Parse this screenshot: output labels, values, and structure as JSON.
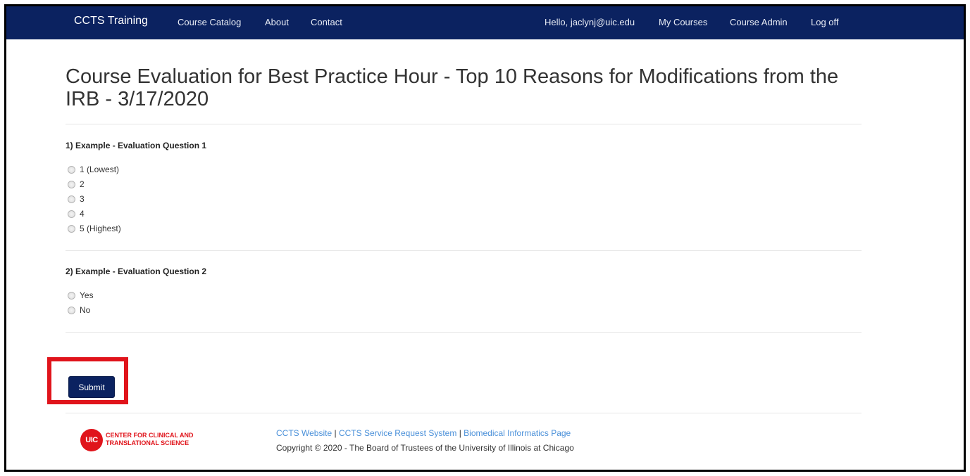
{
  "navbar": {
    "brand": "CCTS Training",
    "left_links": [
      "Course Catalog",
      "About",
      "Contact"
    ],
    "greeting": "Hello, jaclynj@uic.edu",
    "right_links": [
      "My Courses",
      "Course Admin",
      "Log off"
    ]
  },
  "page": {
    "title": "Course Evaluation for Best Practice Hour - Top 10 Reasons for Modifications from the IRB - 3/17/2020"
  },
  "questions": [
    {
      "label": "1) Example - Evaluation Question 1",
      "options": [
        "1 (Lowest)",
        "2",
        "3",
        "4",
        "5 (Highest)"
      ]
    },
    {
      "label": "2) Example - Evaluation Question 2",
      "options": [
        "Yes",
        "No"
      ]
    }
  ],
  "submit_label": "Submit",
  "footer": {
    "logo_badge": "UIC",
    "logo_line1": "CENTER FOR CLINICAL AND",
    "logo_line2": "TRANSLATIONAL SCIENCE",
    "links": [
      "CCTS Website",
      "CCTS Service Request System",
      "Biomedical Informatics Page"
    ],
    "separator": "|",
    "copyright": "Copyright © 2020 - The Board of Trustees of the University of Illinois at Chicago"
  },
  "colors": {
    "navbar": "#0b2260",
    "highlight": "#e0141b",
    "link": "#4a90d9"
  }
}
